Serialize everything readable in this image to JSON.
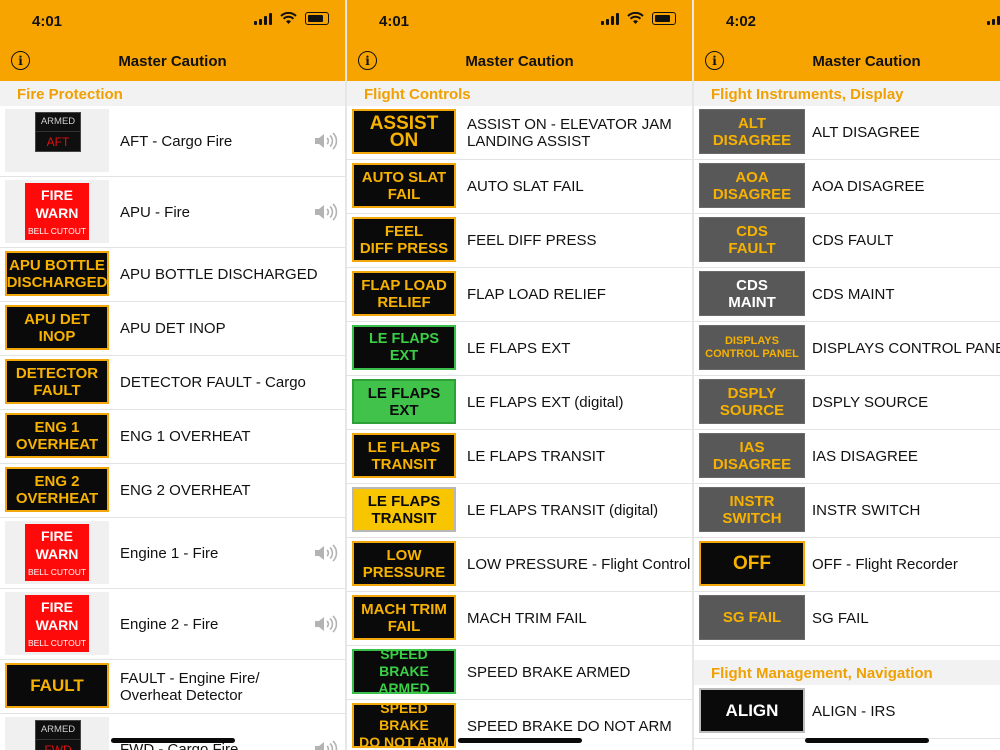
{
  "panels": [
    {
      "time": "4:01",
      "title": "Master Caution",
      "section": "Fire Protection",
      "rows": [
        {
          "kind": "light",
          "light": "dark",
          "top": "ARMED",
          "bottom": "AFT",
          "label": "AFT - Cargo Fire",
          "sound": true
        },
        {
          "kind": "light",
          "light": "fire",
          "line1": "FIRE",
          "line2": "WARN",
          "cut": "BELL CUTOUT",
          "label": "APU - Fire",
          "sound": true
        },
        {
          "kind": "tile",
          "style": "t-amber",
          "l1": "APU BOTTLE",
          "l2": "DISCHARGED",
          "label": "APU BOTTLE DISCHARGED"
        },
        {
          "kind": "tile",
          "style": "t-amber",
          "l1": "APU DET",
          "l2": "INOP",
          "label": "APU DET INOP"
        },
        {
          "kind": "tile",
          "style": "t-amber",
          "l1": "DETECTOR",
          "l2": "FAULT",
          "label": "DETECTOR FAULT - Cargo"
        },
        {
          "kind": "tile",
          "style": "t-amber",
          "l1": "ENG 1",
          "l2": "OVERHEAT",
          "label": "ENG 1 OVERHEAT"
        },
        {
          "kind": "tile",
          "style": "t-amber",
          "l1": "ENG 2",
          "l2": "OVERHEAT",
          "label": "ENG 2 OVERHEAT"
        },
        {
          "kind": "light",
          "light": "fire",
          "line1": "FIRE",
          "line2": "WARN",
          "cut": "BELL CUTOUT",
          "label": "Engine 1 - Fire",
          "sound": true
        },
        {
          "kind": "light",
          "light": "fire",
          "line1": "FIRE",
          "line2": "WARN",
          "cut": "BELL CUTOUT",
          "label": "Engine 2 - Fire",
          "sound": true
        },
        {
          "kind": "tile",
          "style": "t-amber t-fault",
          "l1": "FAULT",
          "l2": "",
          "label": "FAULT - Engine Fire/\nOverheat Detector"
        },
        {
          "kind": "light",
          "light": "dark",
          "top": "ARMED",
          "bottom": "FWD",
          "label": "FWD - Cargo Fire",
          "sound": true
        }
      ]
    },
    {
      "time": "4:01",
      "title": "Master Caution",
      "section": "Flight Controls",
      "rows": [
        {
          "kind": "tile",
          "style": "t-amber-lg",
          "l1": "ASSIST ON",
          "l2": "",
          "label": "ASSIST ON - ELEVATOR JAM\nLANDING ASSIST"
        },
        {
          "kind": "tile",
          "style": "t-amber",
          "l1": "AUTO SLAT",
          "l2": "FAIL",
          "label": "AUTO SLAT FAIL"
        },
        {
          "kind": "tile",
          "style": "t-amber",
          "l1": "FEEL",
          "l2": "DIFF PRESS",
          "label": "FEEL DIFF PRESS"
        },
        {
          "kind": "tile",
          "style": "t-amber",
          "l1": "FLAP LOAD",
          "l2": "RELIEF",
          "label": "FLAP LOAD RELIEF"
        },
        {
          "kind": "tile",
          "style": "t-green",
          "l1": "LE FLAPS",
          "l2": "EXT",
          "label": "LE FLAPS EXT"
        },
        {
          "kind": "tile",
          "style": "t-green-lit",
          "l1": "LE FLAPS",
          "l2": "EXT",
          "label": "LE FLAPS EXT (digital)"
        },
        {
          "kind": "tile",
          "style": "t-amber",
          "l1": "LE FLAPS",
          "l2": "TRANSIT",
          "label": "LE FLAPS TRANSIT"
        },
        {
          "kind": "tile",
          "style": "t-amber-lit",
          "l1": "LE FLAPS",
          "l2": "TRANSIT",
          "label": "LE FLAPS TRANSIT (digital)"
        },
        {
          "kind": "tile",
          "style": "t-amber",
          "l1": "LOW",
          "l2": "PRESSURE",
          "label": "LOW PRESSURE - Flight Control"
        },
        {
          "kind": "tile",
          "style": "t-amber",
          "l1": "MACH TRIM",
          "l2": "FAIL",
          "label": "MACH TRIM FAIL"
        },
        {
          "kind": "tile",
          "style": "t-green t-small",
          "l1": "SPEED BRAKE",
          "l2": "ARMED",
          "label": "SPEED BRAKE ARMED"
        },
        {
          "kind": "tile",
          "style": "t-amber t-small",
          "l1": "SPEED BRAKE",
          "l2": "DO NOT ARM",
          "label": "SPEED BRAKE DO NOT ARM"
        }
      ]
    },
    {
      "time": "4:02",
      "title": "Master Caution",
      "section": "Flight Instruments, Display",
      "section2": "Flight Management, Navigation",
      "rows": [
        {
          "kind": "tile",
          "style": "t-gray",
          "l1": "ALT",
          "l2": "DISAGREE",
          "label": "ALT DISAGREE"
        },
        {
          "kind": "tile",
          "style": "t-gray",
          "l1": "AOA",
          "l2": "DISAGREE",
          "label": "AOA DISAGREE"
        },
        {
          "kind": "tile",
          "style": "t-gray",
          "l1": "CDS",
          "l2": "FAULT",
          "label": "CDS FAULT"
        },
        {
          "kind": "tile",
          "style": "t-gray-w",
          "l1": "CDS",
          "l2": "MAINT",
          "label": "CDS MAINT"
        },
        {
          "kind": "tile",
          "style": "t-gray-sm",
          "l1": "DISPLAYS",
          "l2": "CONTROL PANEL",
          "label": "DISPLAYS CONTROL PANEL"
        },
        {
          "kind": "tile",
          "style": "t-gray",
          "l1": "DSPLY",
          "l2": "SOURCE",
          "label": "DSPLY SOURCE"
        },
        {
          "kind": "tile",
          "style": "t-gray",
          "l1": "IAS",
          "l2": "DISAGREE",
          "label": "IAS DISAGREE"
        },
        {
          "kind": "tile",
          "style": "t-gray",
          "l1": "INSTR",
          "l2": "SWITCH",
          "label": "INSTR SWITCH"
        },
        {
          "kind": "tile",
          "style": "t-amber-lg t-amber-off",
          "l1": "OFF",
          "l2": "",
          "label": "OFF - Flight Recorder"
        },
        {
          "kind": "tile",
          "style": "t-gray",
          "l1": "SG FAIL",
          "l2": "",
          "label": "SG FAIL"
        }
      ],
      "rows2": [
        {
          "kind": "tile",
          "style": "t-white-lg",
          "l1": "ALIGN",
          "l2": "",
          "label": "ALIGN - IRS"
        }
      ]
    }
  ],
  "icons": {
    "info": "info-icon",
    "sound": "speaker-icon",
    "wifi": "wifi-icon",
    "battery": "battery-icon",
    "signal": "signal-icon"
  }
}
